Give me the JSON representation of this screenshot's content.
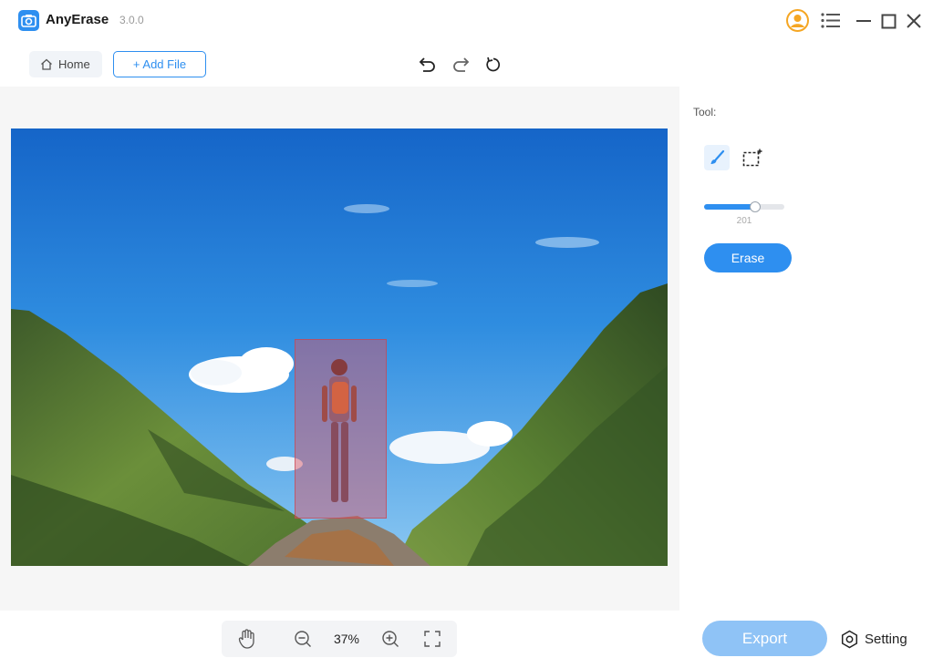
{
  "app": {
    "name": "AnyErase",
    "version": "3.0.0"
  },
  "titlebar": {
    "icons": [
      "account-icon",
      "menu-icon",
      "minimize-icon",
      "maximize-icon",
      "close-icon"
    ],
    "accent_color": "#f5a623"
  },
  "toolbar": {
    "home_label": "Home",
    "add_file_label": "+ Add File",
    "history_icons": [
      "undo-icon",
      "redo-icon",
      "reset-icon"
    ]
  },
  "panel": {
    "tool_label": "Tool:",
    "tools": [
      "brush-icon",
      "rect-select-icon"
    ],
    "active_tool": "brush",
    "brush_size": 201,
    "brush_size_label": "201",
    "brush_size_fraction": 0.64,
    "erase_label": "Erase"
  },
  "bottom": {
    "zoom_value": "37%",
    "export_label": "Export",
    "setting_label": "Setting"
  },
  "colors": {
    "accent": "#2e8ff0",
    "export_disabled": "#8fc3f6",
    "selection_overlay": "#e1505f"
  }
}
